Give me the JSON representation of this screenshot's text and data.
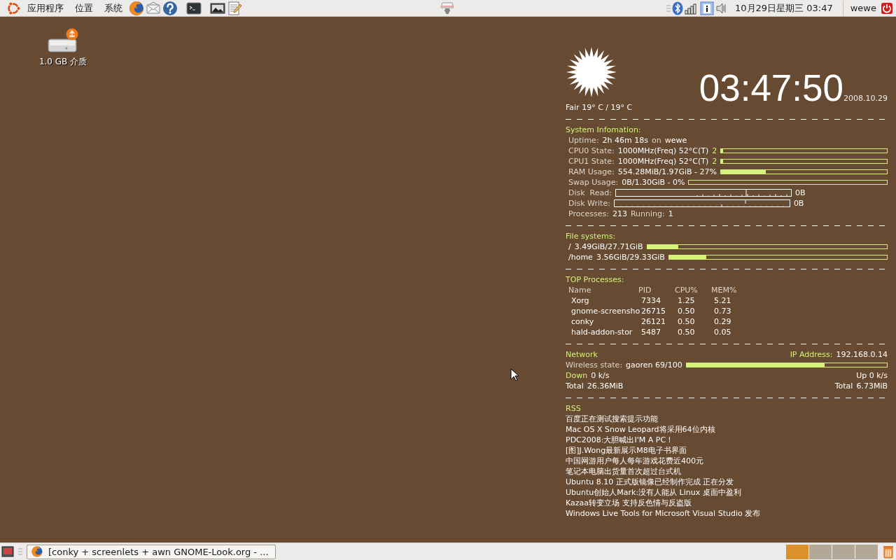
{
  "top_panel": {
    "menus": [
      "应用程序",
      "位置",
      "系统"
    ],
    "clock": "10月29日星期三 03:47",
    "user": "wewe"
  },
  "desktop": {
    "icons": [
      {
        "label": "1.0 GB 介质"
      }
    ]
  },
  "conky": {
    "weather": "Fair 19° C / 19° C",
    "time": "03:47:50",
    "date": "2008.10.29",
    "system": {
      "heading": "System Infomation:",
      "rows": [
        {
          "kind": "text",
          "parts": [
            {
              "kind": "label",
              "text": "Uptime:"
            },
            {
              "kind": "value",
              "text": "2h 46m 18s"
            },
            {
              "kind": "label",
              "text": "on"
            },
            {
              "kind": "value",
              "text": "wewe"
            }
          ]
        },
        {
          "kind": "bar",
          "level": 0.01,
          "parts": [
            {
              "kind": "label",
              "text": "CPU0 State:"
            },
            {
              "kind": "value",
              "text": "1000MHz(Freq) 52°C(T)"
            },
            {
              "kind": "accent",
              "text": "2"
            }
          ]
        },
        {
          "kind": "bar",
          "level": 0.01,
          "parts": [
            {
              "kind": "label",
              "text": "CPU1 State:"
            },
            {
              "kind": "value",
              "text": "1000MHz(Freq) 52°C(T)"
            },
            {
              "kind": "accent",
              "text": "2"
            }
          ]
        },
        {
          "kind": "bar",
          "level": 0.27,
          "parts": [
            {
              "kind": "label",
              "text": "RAM Usage:"
            },
            {
              "kind": "value",
              "text": "554.28MiB/1.97GiB - 27%"
            }
          ]
        },
        {
          "kind": "bar",
          "level": 0,
          "parts": [
            {
              "kind": "label",
              "text": "Swap Usage:"
            },
            {
              "kind": "value",
              "text": "0B/1.30GiB - 0%"
            }
          ]
        },
        {
          "kind": "graph",
          "reading": "0B",
          "parts": [
            {
              "kind": "label",
              "text": "Disk  Read:"
            }
          ]
        },
        {
          "kind": "graph",
          "reading": "0B",
          "parts": [
            {
              "kind": "label",
              "text": "Disk Write:"
            }
          ]
        },
        {
          "kind": "text",
          "parts": [
            {
              "kind": "label",
              "text": "Processes:"
            },
            {
              "kind": "value",
              "text": "213"
            },
            {
              "kind": "label",
              "text": "Running:"
            },
            {
              "kind": "value",
              "text": "1"
            }
          ]
        }
      ]
    },
    "filesystems": {
      "heading": "File systems:",
      "rows": [
        {
          "mount": "/",
          "usage": "3.49GiB/27.71GiB",
          "level": 0.13
        },
        {
          "mount": "/home",
          "usage": "3.56GiB/29.33GiB",
          "level": 0.17
        }
      ]
    },
    "top_processes": {
      "heading": "TOP Processes:",
      "columns": [
        "Name",
        "PID",
        "CPU%",
        "MEM%"
      ],
      "rows": [
        [
          "Xorg",
          "7334",
          "1.25",
          "5.21"
        ],
        [
          "gnome-screensho",
          "26715",
          "0.50",
          "0.73"
        ],
        [
          "conky",
          "26121",
          "0.50",
          "0.29"
        ],
        [
          "hald-addon-stor",
          "5487",
          "0.50",
          "0.05"
        ]
      ]
    },
    "network": {
      "heading": "Network",
      "ip_label": "IP Address:",
      "ip": "192.168.0.14",
      "wireless_label": "Wireless state:",
      "wireless_value": "gaoren 69/100",
      "level": 0.69,
      "down_label": "Down",
      "down": "0 k/s",
      "up": "Up 0 k/s",
      "down_total_label": "Total",
      "down_total": "26.36MiB",
      "up_total_label": "Total",
      "up_total": "6.73MiB"
    },
    "rss": {
      "heading": "RSS",
      "items": [
        "百度正在测试搜索提示功能",
        "Mac OS X Snow Leopard将采用64位内核",
        "PDC2008:大胆喊出I'M A PC！",
        "[图]J.Wong最新展示M8电子书界面",
        "中国网游用户每人每年游戏花费近400元",
        "笔记本电脑出货量首次超过台式机",
        "Ubuntu 8.10 正式版镜像已经制作完成 正在分发",
        "Ubuntu创始人Mark:没有人能从 Linux 桌面中盈利",
        "Kazaa转变立场 支持反色情与反盗版",
        "Windows Live Tools for Microsoft Visual Studio 发布"
      ]
    }
  },
  "bottom_panel": {
    "task": "[conky + screenlets + awn GNOME-Look.org - ...",
    "workspaces": [
      {
        "selected": true
      },
      {
        "selected": false
      },
      {
        "selected": false
      },
      {
        "selected": false
      }
    ]
  }
}
